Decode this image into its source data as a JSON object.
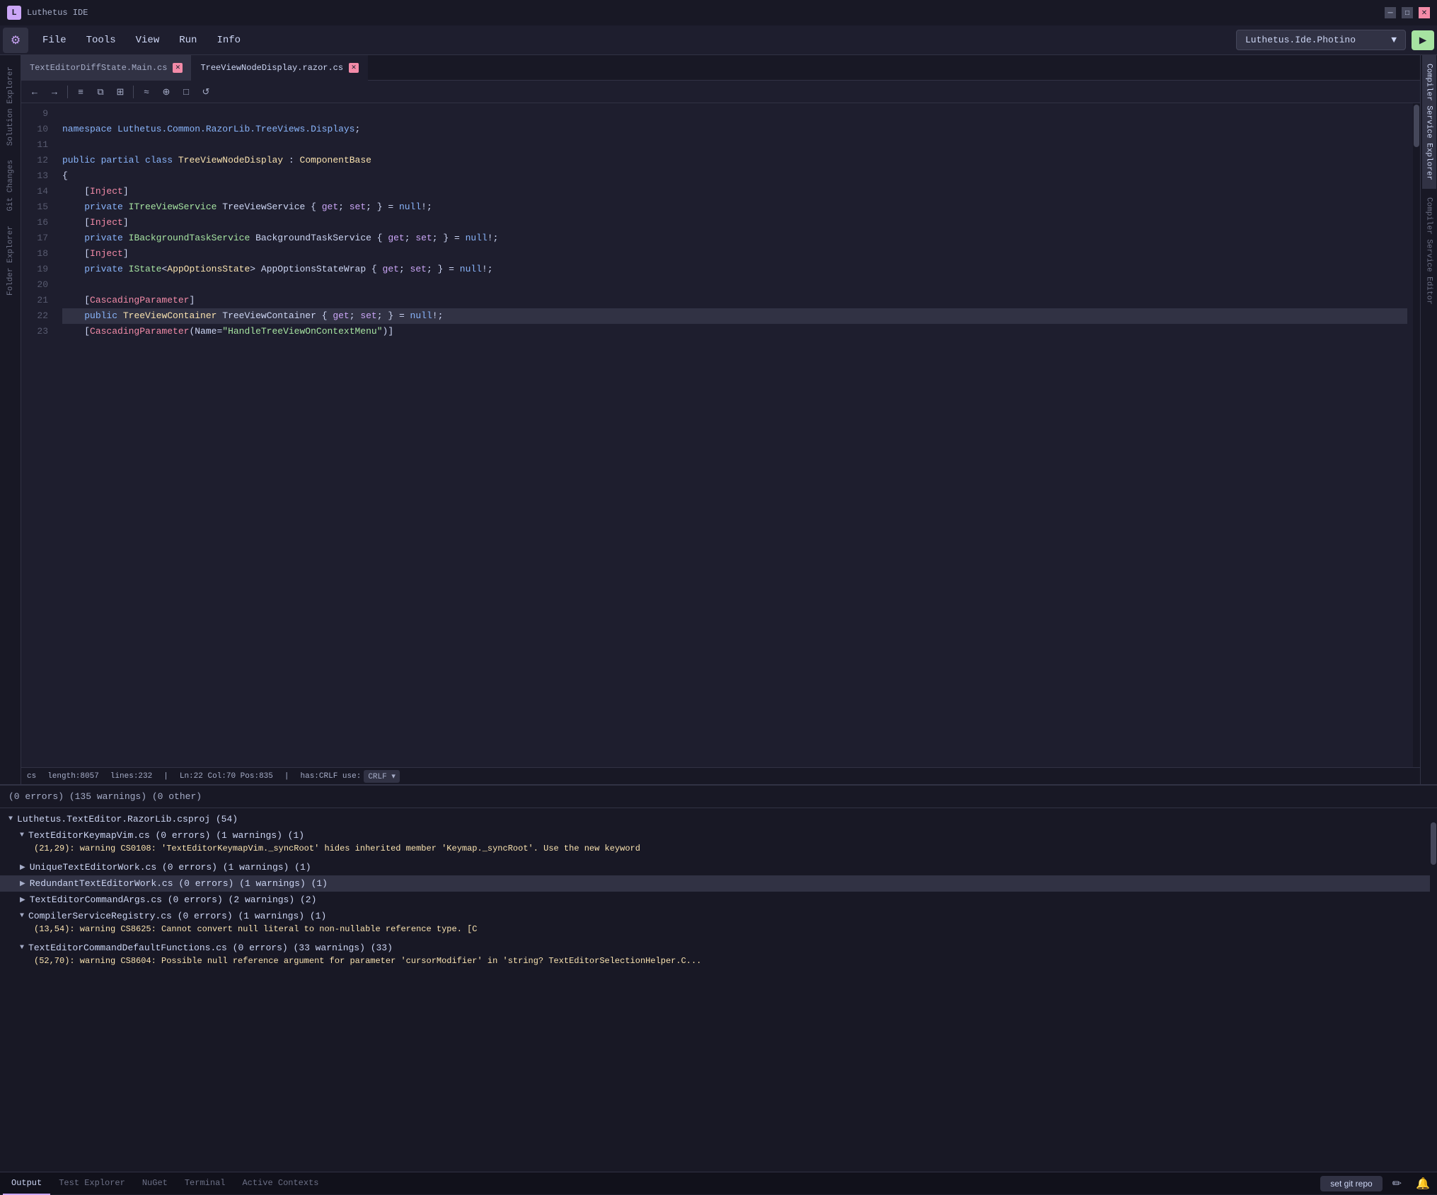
{
  "app": {
    "title": "Luthetus IDE",
    "icon_label": "L"
  },
  "title_bar": {
    "text": "Luthetus IDE",
    "minimize_label": "─",
    "maximize_label": "□",
    "close_label": "✕"
  },
  "menu": {
    "items": [
      "File",
      "Tools",
      "View",
      "Run",
      "Info"
    ],
    "project_dropdown": "Luthetus.Ide.Photino",
    "run_icon": "▶"
  },
  "left_sidebar": {
    "tabs": [
      "Solution Explorer",
      "Git Changes",
      "Folder Explorer"
    ]
  },
  "right_sidebar": {
    "tabs": [
      "Compiler Service Explorer",
      "Compiler Service Editor"
    ]
  },
  "editor": {
    "tabs": [
      {
        "label": "TextEditorDiffState.Main.cs",
        "active": false,
        "close_color": "#f38ba8"
      },
      {
        "label": "TreeViewNodeDisplay.razor.cs",
        "active": true,
        "close_color": "#f38ba8"
      }
    ],
    "toolbar_buttons": [
      "←",
      "→",
      "≡",
      "⧉",
      "⊞",
      "≈",
      "⊕",
      "□",
      "↺"
    ],
    "lines": [
      {
        "num": 9,
        "content": ""
      },
      {
        "num": 10,
        "content": "namespace Luthetus.Common.RazorLib.TreeViews.Displays;"
      },
      {
        "num": 11,
        "content": ""
      },
      {
        "num": 12,
        "content": "public partial class TreeViewNodeDisplay : ComponentBase"
      },
      {
        "num": 13,
        "content": "{"
      },
      {
        "num": 14,
        "content": "    [Inject]"
      },
      {
        "num": 15,
        "content": "    private ITreeViewService TreeViewService { get; set; } = null!;"
      },
      {
        "num": 16,
        "content": "    [Inject]"
      },
      {
        "num": 17,
        "content": "    private IBackgroundTaskService BackgroundTaskService { get; set; } = null!;"
      },
      {
        "num": 18,
        "content": "    [Inject]"
      },
      {
        "num": 19,
        "content": "    private IState<AppOptionsState> AppOptionsStateWrap { get; set; } = null!;"
      },
      {
        "num": 20,
        "content": ""
      },
      {
        "num": 21,
        "content": "    [CascadingParameter]"
      },
      {
        "num": 22,
        "content": "    public TreeViewContainer TreeViewContainer { get; set; } = null!;",
        "highlighted": true
      },
      {
        "num": 23,
        "content": "    [CascadingParameter(Name=\"HandleTreeViewOnContextMenu\")]"
      }
    ],
    "status": {
      "file_type": "cs",
      "length": "length:8057",
      "lines": "lines:232",
      "cursor": "Ln:22  Col:70  Pos:835",
      "line_ending": "has:CRLF  use: CRLF"
    }
  },
  "bottom_panel": {
    "summary": "(0 errors) (135 warnings) (0 other)",
    "groups": [
      {
        "label": "Luthetus.TextEditor.RazorLib.csproj (54)",
        "expanded": true,
        "children": [
          {
            "label": "TextEditorKeymapVim.cs (0 errors) (1 warnings) (1)",
            "expanded": true,
            "detail": "(21,29): warning CS0108: 'TextEditorKeymapVim._syncRoot' hides inherited member 'Keymap._syncRoot'. Use the new keyword"
          },
          {
            "label": "UniqueTextEditorWork.cs (0 errors) (1 warnings) (1)",
            "expanded": false
          },
          {
            "label": "RedundantTextEditorWork.cs (0 errors) (1 warnings) (1)",
            "expanded": false,
            "selected": true
          },
          {
            "label": "TextEditorCommandArgs.cs (0 errors) (2 warnings) (2)",
            "expanded": false
          },
          {
            "label": "CompilerServiceRegistry.cs (0 errors) (1 warnings) (1)",
            "expanded": true,
            "detail": "(13,54): warning CS8625: Cannot convert null literal to non-nullable reference type. [C"
          },
          {
            "label": "TextEditorCommandDefaultFunctions.cs (0 errors) (33 warnings) (33)",
            "expanded": true,
            "detail": "(52,70): warning CS8604: Possible null reference argument for parameter 'cursorModifier' in 'string? TextEditorSelectionHelper.C..."
          }
        ]
      }
    ],
    "tabs": [
      "Output",
      "Test Explorer",
      "NuGet",
      "Terminal",
      "Active Contexts"
    ],
    "active_tab": "Output",
    "right_buttons": {
      "set_git_repo": "set git repo",
      "edit_icon": "✏",
      "bell_icon": "🔔"
    }
  }
}
